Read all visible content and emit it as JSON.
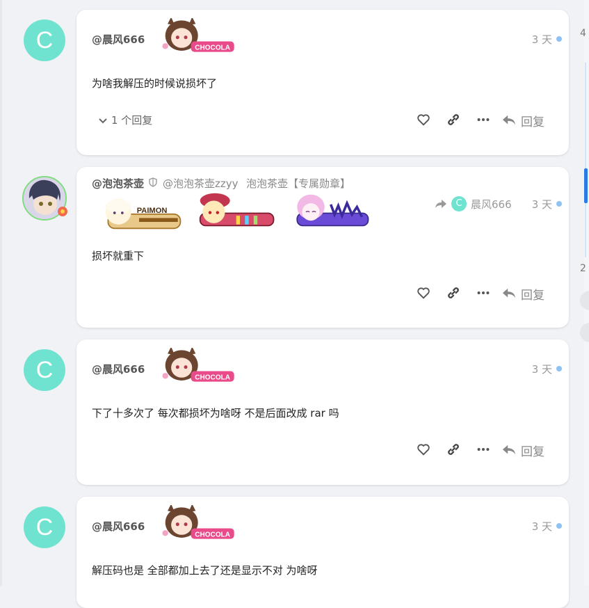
{
  "posts": [
    {
      "avatar_letter": "C",
      "username": "@晨风666",
      "badges": [
        "CHOCOLA"
      ],
      "time": "3 天",
      "content": "为啥我解压的时候说损坏了",
      "expander": "1 个回复",
      "reply_label": "回复"
    },
    {
      "username": "@泡泡茶壶",
      "handle": "@泡泡茶壶zzyy",
      "title": "泡泡茶壶【专属勋章】",
      "badges": [
        "PAIMON",
        "",
        ""
      ],
      "reply_to_letter": "C",
      "reply_to_name": "晨风666",
      "time": "3 天",
      "content": "损坏就重下",
      "reply_label": "回复"
    },
    {
      "avatar_letter": "C",
      "username": "@晨风666",
      "badges": [
        "CHOCOLA"
      ],
      "time": "3 天",
      "content": "下了十多次了 每次都损坏为啥呀 不是后面改成 rar 吗",
      "reply_label": "回复"
    },
    {
      "avatar_letter": "C",
      "username": "@晨风666",
      "badges": [
        "CHOCOLA"
      ],
      "time": "3 天",
      "content": "解压码也是 全部都加上去了还是显示不对 为啥呀"
    }
  ],
  "scroll_rail": {
    "top_number": "4",
    "bottom_number": "2"
  },
  "colors": {
    "avatar": "#6fe3d0",
    "online_dot": "#8ec1f4",
    "card_bg": "#ffffff",
    "page_bg": "#f0f2f5"
  }
}
